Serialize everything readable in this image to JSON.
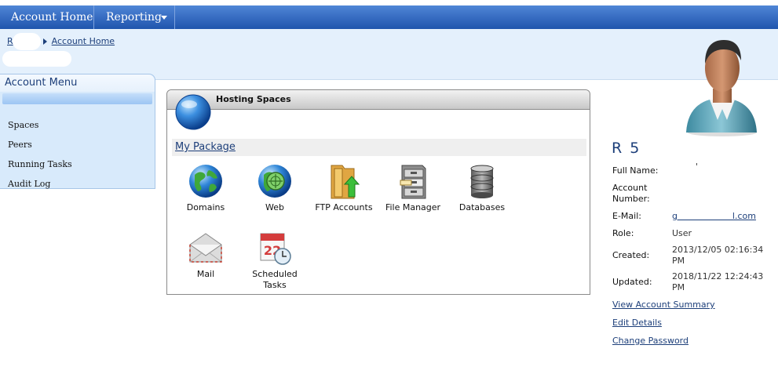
{
  "topnav": {
    "items": [
      {
        "label": "Account Home"
      },
      {
        "label": "Reporting"
      }
    ]
  },
  "breadcrumb": {
    "root": "R",
    "current": "Account Home"
  },
  "account_menu": {
    "title": "Account Menu",
    "items": [
      {
        "label": "Spaces"
      },
      {
        "label": "Peers"
      },
      {
        "label": "Running Tasks"
      },
      {
        "label": "Audit Log"
      }
    ]
  },
  "hosting": {
    "title": "Hosting Spaces",
    "package_link": "My Package",
    "tiles": [
      {
        "label": "Domains",
        "icon": "globe-icon"
      },
      {
        "label": "Web",
        "icon": "web-globe-icon"
      },
      {
        "label": "FTP Accounts",
        "icon": "ftp-folder-icon"
      },
      {
        "label": "File Manager",
        "icon": "file-cabinet-icon"
      },
      {
        "label": "Databases",
        "icon": "database-icon"
      },
      {
        "label": "Mail",
        "icon": "envelope-icon"
      },
      {
        "label": "Scheduled Tasks",
        "icon": "calendar-clock-icon"
      }
    ]
  },
  "profile": {
    "name": "R   5",
    "fields": [
      {
        "label": "Full Name:",
        "value": "'"
      },
      {
        "label": "Account Number:",
        "value": ""
      },
      {
        "label": "E-Mail:",
        "value": "g                    l.com"
      },
      {
        "label": "Role:",
        "value": "User"
      },
      {
        "label": "Created:",
        "value": "2013/12/05 02:16:34 PM"
      },
      {
        "label": "Updated:",
        "value": "2018/11/22 12:24:43 PM"
      }
    ],
    "links": [
      {
        "label": "View Account Summary"
      },
      {
        "label": "Edit Details"
      },
      {
        "label": "Change Password"
      }
    ]
  },
  "colors": {
    "nav_blue": "#3a6fc4",
    "header_band": "#e4f0fc",
    "link": "#1d3f7a",
    "menu_bg": "#d8eafb"
  }
}
